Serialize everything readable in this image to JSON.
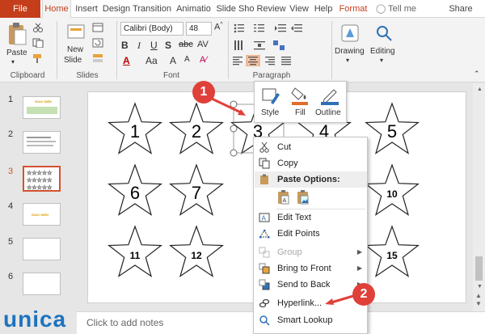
{
  "tabs": [
    "File",
    "Home",
    "Insert",
    "Design",
    "Transition",
    "Animatio",
    "Slide Sho",
    "Review",
    "View",
    "Help",
    "Format"
  ],
  "tell_me": "Tell me",
  "share": "Share",
  "ribbon": {
    "clipboard": {
      "label": "Clipboard",
      "paste": "Paste"
    },
    "slides": {
      "label": "Slides",
      "new_slide": "New",
      "new_slide2": "Slide"
    },
    "font": {
      "label": "Font",
      "font_name": "Calibri (Body)",
      "font_size": "48"
    },
    "paragraph": {
      "label": "Paragraph"
    },
    "drawing": "Drawing",
    "editing": "Editing"
  },
  "thumbnails": [
    {
      "num": "1",
      "text": "GIAO DIỆN"
    },
    {
      "num": "2",
      "text": ""
    },
    {
      "num": "3",
      "text": ""
    },
    {
      "num": "4",
      "text": "GIAO DIỆN"
    },
    {
      "num": "5",
      "text": ""
    },
    {
      "num": "6",
      "text": ""
    }
  ],
  "stars": [
    "1",
    "2",
    "3",
    "4",
    "5",
    "6",
    "7",
    "10",
    "11",
    "12",
    "15"
  ],
  "mini_toolbar": {
    "style": "Style",
    "fill": "Fill",
    "outline": "Outline"
  },
  "context_menu": {
    "cut": "Cut",
    "copy": "Copy",
    "paste_options": "Paste Options:",
    "edit_text": "Edit Text",
    "edit_points": "Edit Points",
    "group": "Group",
    "bring_to_front": "Bring to Front",
    "send_to_back": "Send to Back",
    "hyperlink": "Hyperlink...",
    "smart_lookup": "Smart Lookup"
  },
  "notes_placeholder": "Click to add notes",
  "callouts": [
    "1",
    "2"
  ],
  "logo": "unica",
  "colors": {
    "accent": "#c43e1c",
    "badge": "#e0403a",
    "logo": "#1e73be"
  }
}
